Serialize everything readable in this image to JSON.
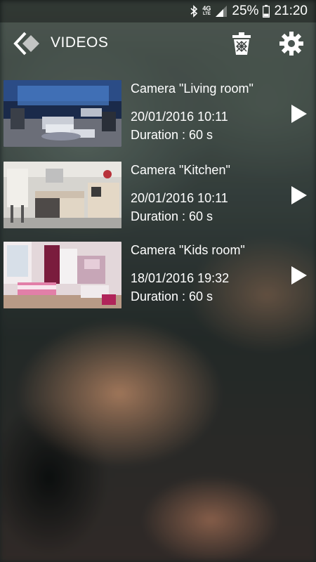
{
  "status_bar": {
    "network_top": "4G",
    "network_bottom": "LTE",
    "battery_percent": "25%",
    "time": "21:20"
  },
  "app_bar": {
    "title": "VIDEOS"
  },
  "videos": [
    {
      "camera": "Camera \"Living room\"",
      "datetime": "20/01/2016 10:11",
      "duration": "Duration : 60 s"
    },
    {
      "camera": "Camera \"Kitchen\"",
      "datetime": "20/01/2016 10:11",
      "duration": "Duration : 60 s"
    },
    {
      "camera": "Camera \"Kids room\"",
      "datetime": "18/01/2016 19:32",
      "duration": "Duration : 60 s"
    }
  ],
  "icons": {
    "back": "back-chevron-icon",
    "trash": "trash-icon",
    "settings": "gear-icon",
    "play": "play-icon",
    "bluetooth": "bluetooth-icon",
    "signal": "signal-icon",
    "battery": "battery-icon"
  },
  "colors": {
    "text": "#ffffff",
    "status_bar_bg": "#000000"
  }
}
